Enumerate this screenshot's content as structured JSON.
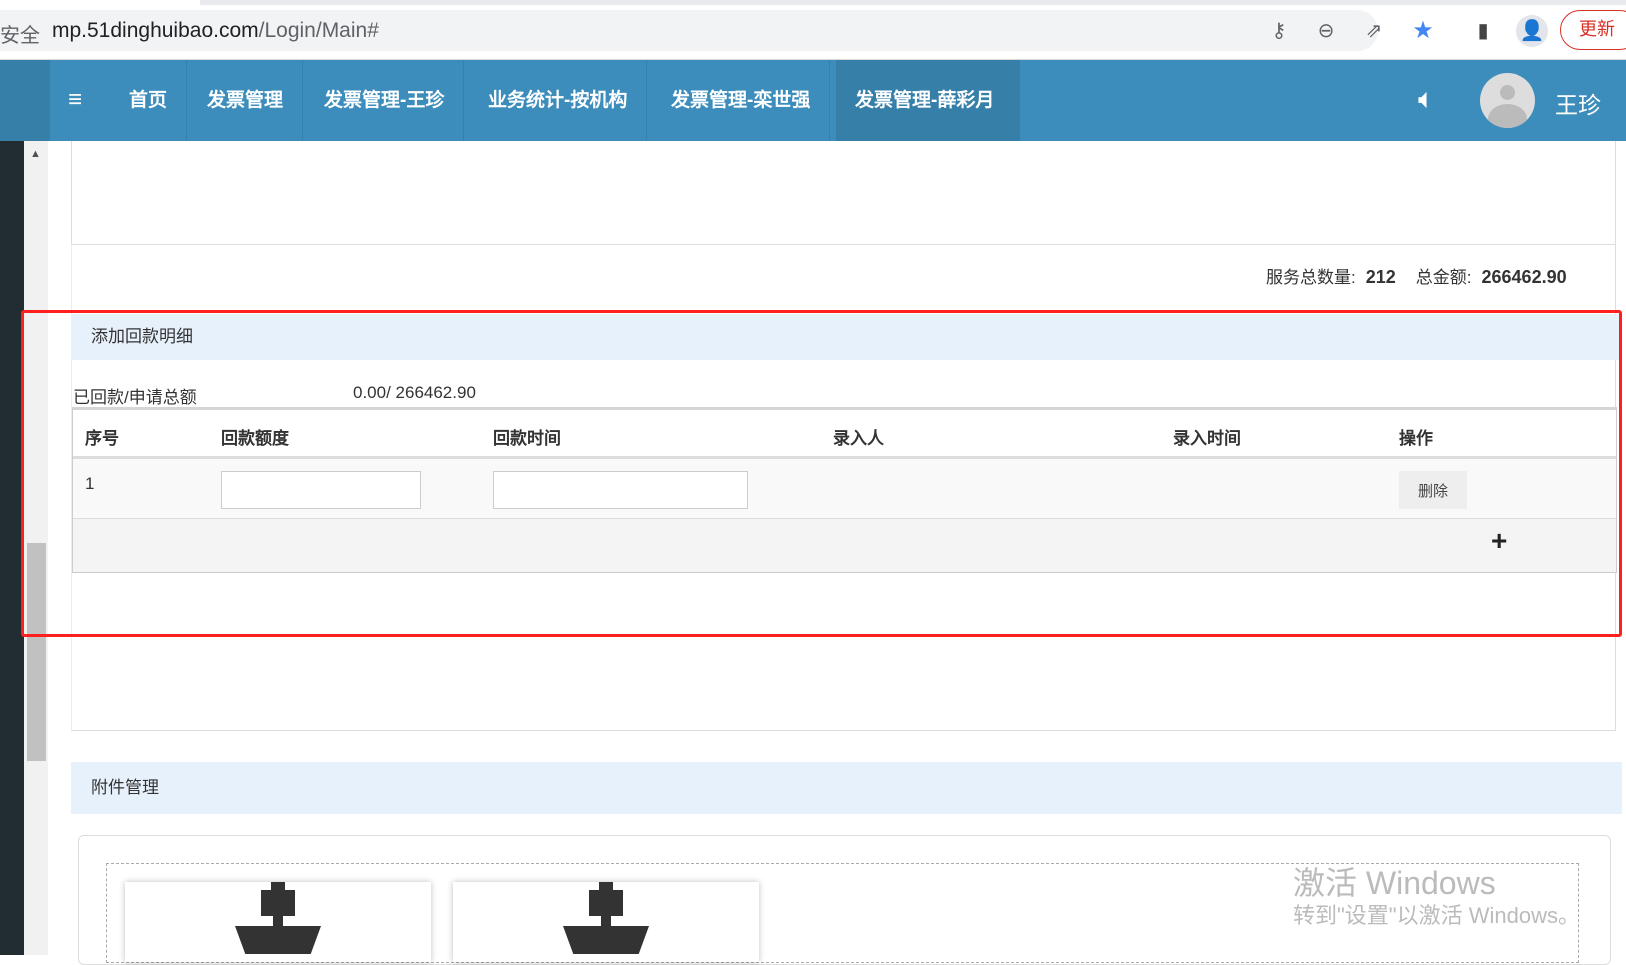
{
  "browser": {
    "security_label": "安全",
    "url_host": "mp.51dinghuibao.com",
    "url_path": "/Login/Main#",
    "update_label": "更新"
  },
  "nav": {
    "items": [
      "首页",
      "发票管理",
      "发票管理-王珍",
      "业务统计-按机构",
      "发票管理-栾世强",
      "发票管理-薛彩月"
    ],
    "active_index": 5,
    "user_name": "王珍"
  },
  "summary": {
    "service_count_label": "服务总数量:",
    "service_count": "212",
    "total_label": "总金额:",
    "total": "266462.90"
  },
  "payment": {
    "section_title": "添加回款明细",
    "paid_label": "已回款/申请总额",
    "paid_value": "0.00/ 266462.90",
    "columns": [
      "序号",
      "回款额度",
      "回款时间",
      "录入人",
      "录入时间",
      "操作"
    ],
    "rows": [
      {
        "index": "1",
        "amount": "",
        "time": "",
        "entered_by": "",
        "entered_time": "",
        "delete_label": "删除"
      }
    ]
  },
  "attachments": {
    "section_title": "附件管理"
  },
  "watermark": {
    "line1": "激活 Windows",
    "line2": "转到\"设置\"以激活 Windows。"
  },
  "colors": {
    "nav": "#3c8dbc",
    "nav_active": "#367fa9",
    "section_bg": "#e7f1fb",
    "highlight": "#ff1f1f"
  }
}
